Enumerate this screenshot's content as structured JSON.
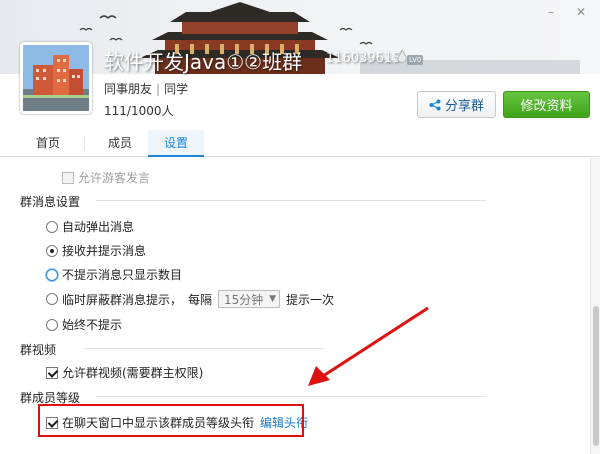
{
  "window": {
    "minimize_glyph": "–",
    "close_glyph": "✕"
  },
  "group": {
    "name": "软件开发Java①②班群",
    "number": "116039615",
    "level_badge": "LV0",
    "tags": [
      "同事朋友",
      "同学"
    ],
    "members": "111/1000人"
  },
  "buttons": {
    "share": "分享群",
    "edit": "修改资料"
  },
  "tabs": [
    {
      "label": "首页",
      "active": false
    },
    {
      "label": "成员",
      "active": false
    },
    {
      "label": "设置",
      "active": true
    }
  ],
  "settings": {
    "allow_guest": {
      "label": "允许游客发言",
      "checked": false,
      "disabled": true
    },
    "message_section": {
      "title": "群消息设置",
      "options": [
        {
          "label": "自动弹出消息",
          "selected": false
        },
        {
          "label": "接收并提示消息",
          "selected": true
        },
        {
          "label": "不提示消息只显示数目",
          "selected": false
        },
        {
          "label": "临时屏蔽群消息提示，",
          "selected": false
        },
        {
          "label": "始终不提示",
          "selected": false
        }
      ],
      "interval_prefix": "每隔",
      "interval_value": "15分钟",
      "interval_suffix": "提示一次"
    },
    "video_section": {
      "title": "群视频",
      "allow_video": {
        "label": "允许群视频(需要群主权限)",
        "checked": true
      }
    },
    "level_section": {
      "title": "群成员等级",
      "show_level": {
        "label": "在聊天窗口中显示该群成员等级头衔",
        "checked": true
      },
      "edit_link": "编辑头衔"
    }
  },
  "colors": {
    "accent": "#1c86d6",
    "green": "#3ea41a",
    "annotation": "#e01010"
  }
}
